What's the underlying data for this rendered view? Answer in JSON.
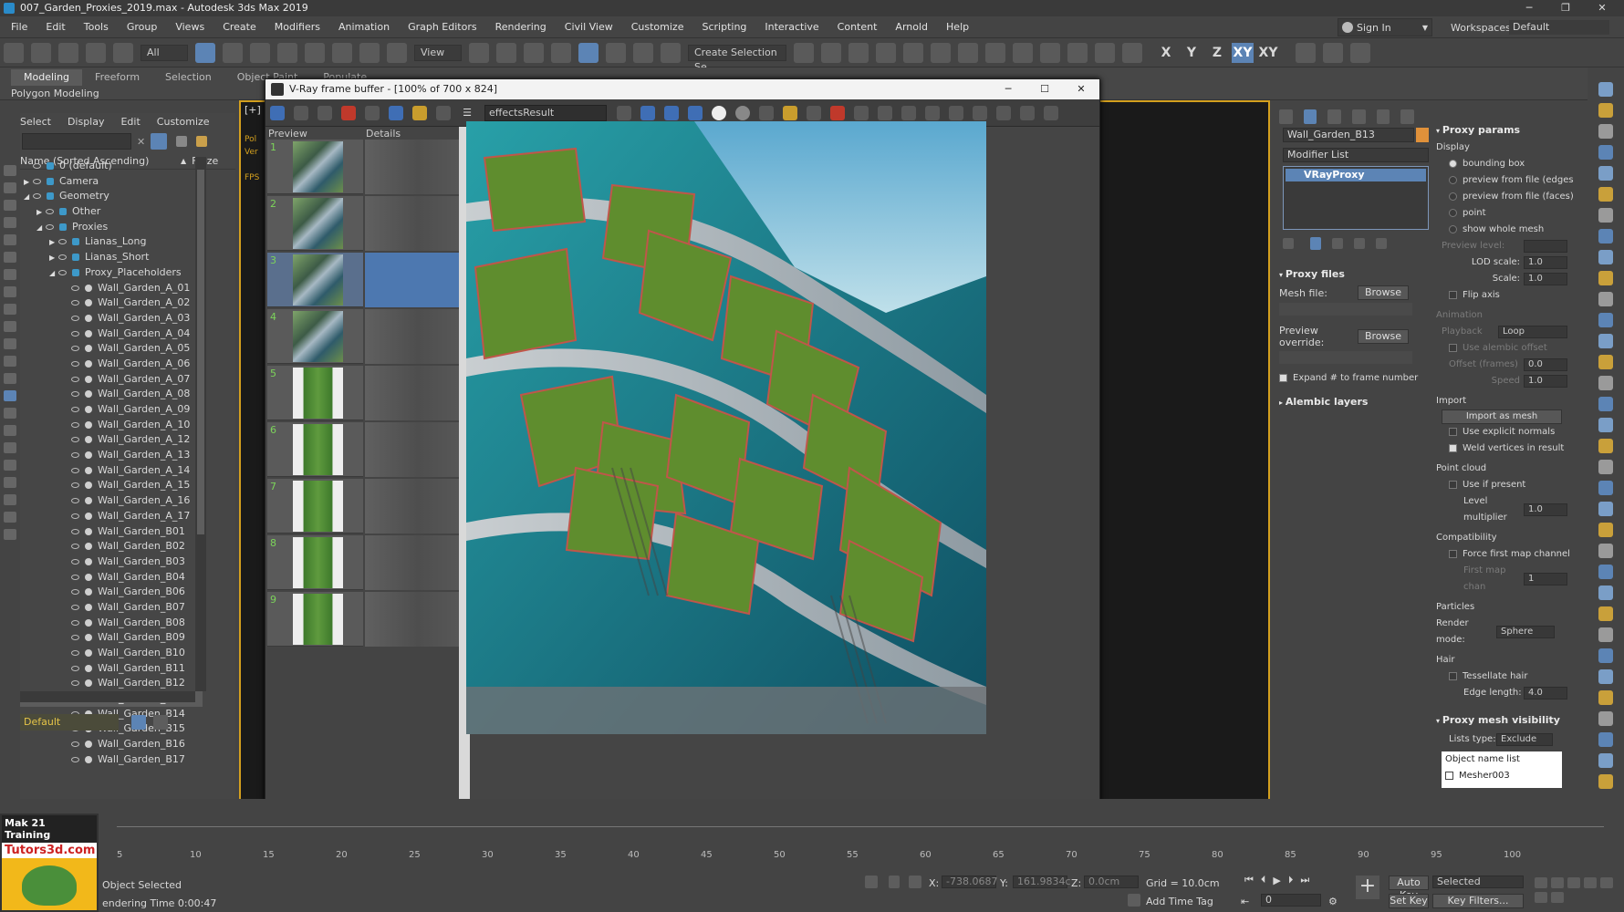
{
  "window": {
    "title": "007_Garden_Proxies_2019.max - Autodesk 3ds Max 2019"
  },
  "menu": [
    "File",
    "Edit",
    "Tools",
    "Group",
    "Views",
    "Create",
    "Modifiers",
    "Animation",
    "Graph Editors",
    "Rendering",
    "Civil View",
    "Customize",
    "Scripting",
    "Interactive",
    "Content",
    "Arnold",
    "Help"
  ],
  "user": {
    "sign_in": "Sign In",
    "workspaces_label": "Workspaces:",
    "workspace": "Default"
  },
  "toolbar": {
    "filter": "All",
    "ref_coord": "View",
    "selection_set": "Create Selection Se",
    "axes": [
      "X",
      "Y",
      "Z",
      "XY",
      "XY"
    ]
  },
  "ribbon": {
    "tabs": [
      "Modeling",
      "Freeform",
      "Selection",
      "Object Paint",
      "Populate"
    ],
    "sub": "Polygon Modeling"
  },
  "scene_explorer": {
    "menu": [
      "Select",
      "Display",
      "Edit",
      "Customize"
    ],
    "header": "Name (Sorted Ascending)",
    "header2": "Froze",
    "items": [
      {
        "label": "0 (default)",
        "lvl": 1,
        "arrow": ""
      },
      {
        "label": "Camera",
        "lvl": 1,
        "arrow": "▶"
      },
      {
        "label": "Geometry",
        "lvl": 1,
        "arrow": "◢"
      },
      {
        "label": "Other",
        "lvl": 2,
        "arrow": "▶"
      },
      {
        "label": "Proxies",
        "lvl": 2,
        "arrow": "◢"
      },
      {
        "label": "Lianas_Long",
        "lvl": 3,
        "arrow": "▶"
      },
      {
        "label": "Lianas_Short",
        "lvl": 3,
        "arrow": "▶"
      },
      {
        "label": "Proxy_Placeholders",
        "lvl": 3,
        "arrow": "◢"
      },
      {
        "label": "Wall_Garden_A_01",
        "lvl": 4
      },
      {
        "label": "Wall_Garden_A_02",
        "lvl": 4
      },
      {
        "label": "Wall_Garden_A_03",
        "lvl": 4
      },
      {
        "label": "Wall_Garden_A_04",
        "lvl": 4
      },
      {
        "label": "Wall_Garden_A_05",
        "lvl": 4
      },
      {
        "label": "Wall_Garden_A_06",
        "lvl": 4
      },
      {
        "label": "Wall_Garden_A_07",
        "lvl": 4
      },
      {
        "label": "Wall_Garden_A_08",
        "lvl": 4
      },
      {
        "label": "Wall_Garden_A_09",
        "lvl": 4
      },
      {
        "label": "Wall_Garden_A_10",
        "lvl": 4
      },
      {
        "label": "Wall_Garden_A_12",
        "lvl": 4
      },
      {
        "label": "Wall_Garden_A_13",
        "lvl": 4
      },
      {
        "label": "Wall_Garden_A_14",
        "lvl": 4
      },
      {
        "label": "Wall_Garden_A_15",
        "lvl": 4
      },
      {
        "label": "Wall_Garden_A_16",
        "lvl": 4
      },
      {
        "label": "Wall_Garden_A_17",
        "lvl": 4
      },
      {
        "label": "Wall_Garden_B01",
        "lvl": 4
      },
      {
        "label": "Wall_Garden_B02",
        "lvl": 4
      },
      {
        "label": "Wall_Garden_B03",
        "lvl": 4
      },
      {
        "label": "Wall_Garden_B04",
        "lvl": 4
      },
      {
        "label": "Wall_Garden_B06",
        "lvl": 4
      },
      {
        "label": "Wall_Garden_B07",
        "lvl": 4
      },
      {
        "label": "Wall_Garden_B08",
        "lvl": 4
      },
      {
        "label": "Wall_Garden_B09",
        "lvl": 4
      },
      {
        "label": "Wall_Garden_B10",
        "lvl": 4
      },
      {
        "label": "Wall_Garden_B11",
        "lvl": 4
      },
      {
        "label": "Wall_Garden_B12",
        "lvl": 4
      },
      {
        "label": "Wall_Garden_B13",
        "lvl": 4,
        "sel": true
      },
      {
        "label": "Wall_Garden_B14",
        "lvl": 4
      },
      {
        "label": "Wall_Garden_B15",
        "lvl": 4
      },
      {
        "label": "Wall_Garden_B16",
        "lvl": 4
      },
      {
        "label": "Wall_Garden_B17",
        "lvl": 4
      }
    ],
    "layer": "Default"
  },
  "viewport": {
    "label": "[+]",
    "side": [
      "Pol",
      "Ver",
      "FPS"
    ]
  },
  "vfb": {
    "title": "V-Ray frame buffer - [100% of 700 x 824]",
    "channel": "effectsResult",
    "history_cols": [
      "Preview",
      "Details"
    ],
    "history": [
      "1",
      "2",
      "3",
      "4",
      "5",
      "6",
      "7",
      "8",
      "9"
    ]
  },
  "cmd": {
    "object_name": "Wall_Garden_B13",
    "modifier_list": "Modifier List",
    "stack_item": "VRayProxy",
    "proxy_files": "Proxy files",
    "mesh_file": "Mesh file:",
    "browse": "Browse",
    "preview_override": "Preview override:",
    "expand": "Expand # to frame number",
    "alembic": "Alembic layers",
    "params": "Proxy params",
    "display": "Display",
    "display_opts": [
      "bounding box",
      "preview from file (edges",
      "preview from file (faces)",
      "point",
      "show whole mesh"
    ],
    "preview_level": "Preview level:",
    "lod_scale": "LOD scale:",
    "lod_val": "1.0",
    "scale": "Scale:",
    "scale_val": "1.0",
    "flip": "Flip axis",
    "animation": "Animation",
    "playback": "Playback",
    "playback_val": "Loop",
    "use_alembic": "Use alembic offset",
    "offset": "Offset (frames)",
    "offset_val": "0.0",
    "speed": "Speed",
    "speed_val": "1.0",
    "import": "Import",
    "import_btn": "Import as mesh",
    "explicit": "Use explicit normals",
    "weld": "Weld vertices in result",
    "point_cloud": "Point cloud",
    "use_present": "Use if present",
    "level_mult": "Level multiplier",
    "level_val": "1.0",
    "compat": "Compatibility",
    "force_first": "Force first map channel",
    "first_map": "First map chan",
    "first_map_val": "1",
    "particles": "Particles",
    "render_mode": "Render mode:",
    "render_val": "Sphere",
    "hair": "Hair",
    "tess": "Tessellate hair",
    "edge_len": "Edge length:",
    "edge_val": "4.0",
    "visibility": "Proxy mesh visibility",
    "lists_type": "Lists type:",
    "lists_val": "Exclude",
    "obj_list": "Object name list",
    "mesh_item": "Mesher003"
  },
  "status": {
    "selected": "Object Selected",
    "render_time": "endering Time  0:00:47",
    "x_label": "X:",
    "x": "-738.0687",
    "y_label": "Y:",
    "y": "161.9834c",
    "z_label": "Z:",
    "z": "0.0cm",
    "grid": "Grid = 10.0cm",
    "add_time_tag": "Add Time Tag",
    "auto_key": "Auto Key",
    "set_key": "Set Key",
    "selected_drop": "Selected",
    "key_filters": "Key Filters...",
    "frame": "0"
  },
  "timeline": {
    "ticks": [
      "5",
      "10",
      "15",
      "20",
      "25",
      "30",
      "35",
      "40",
      "45",
      "50",
      "55",
      "60",
      "65",
      "70",
      "75",
      "80",
      "85",
      "90",
      "95",
      "100"
    ]
  },
  "logo": {
    "line1": "Mak 21 Training",
    "line2": "Tutors3d.com"
  }
}
